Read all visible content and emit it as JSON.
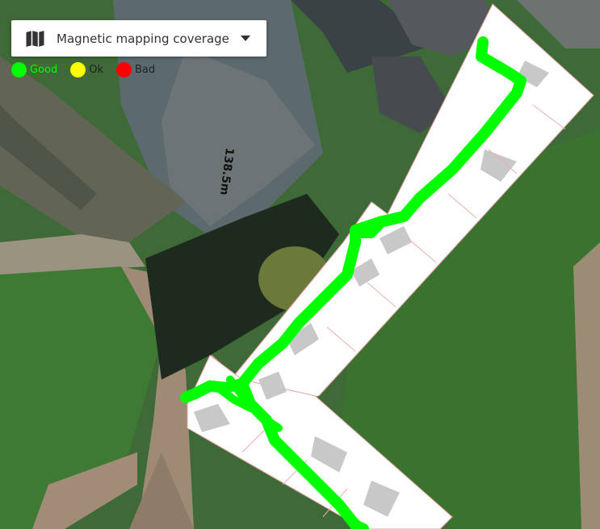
{
  "layer_selector": {
    "label": "Magnetic mapping coverage",
    "icon": "map-icon"
  },
  "legend": {
    "items": [
      {
        "label": "Good",
        "color": "#00ff00"
      },
      {
        "label": "Ok",
        "color": "#ffff00"
      },
      {
        "label": "Bad",
        "color": "#ff0000"
      }
    ]
  },
  "map": {
    "distance_label": "138.5m",
    "coverage_color": "#00ff00",
    "floorplan_fill": "#ffffff",
    "room_shade": "#c8c8c8"
  }
}
